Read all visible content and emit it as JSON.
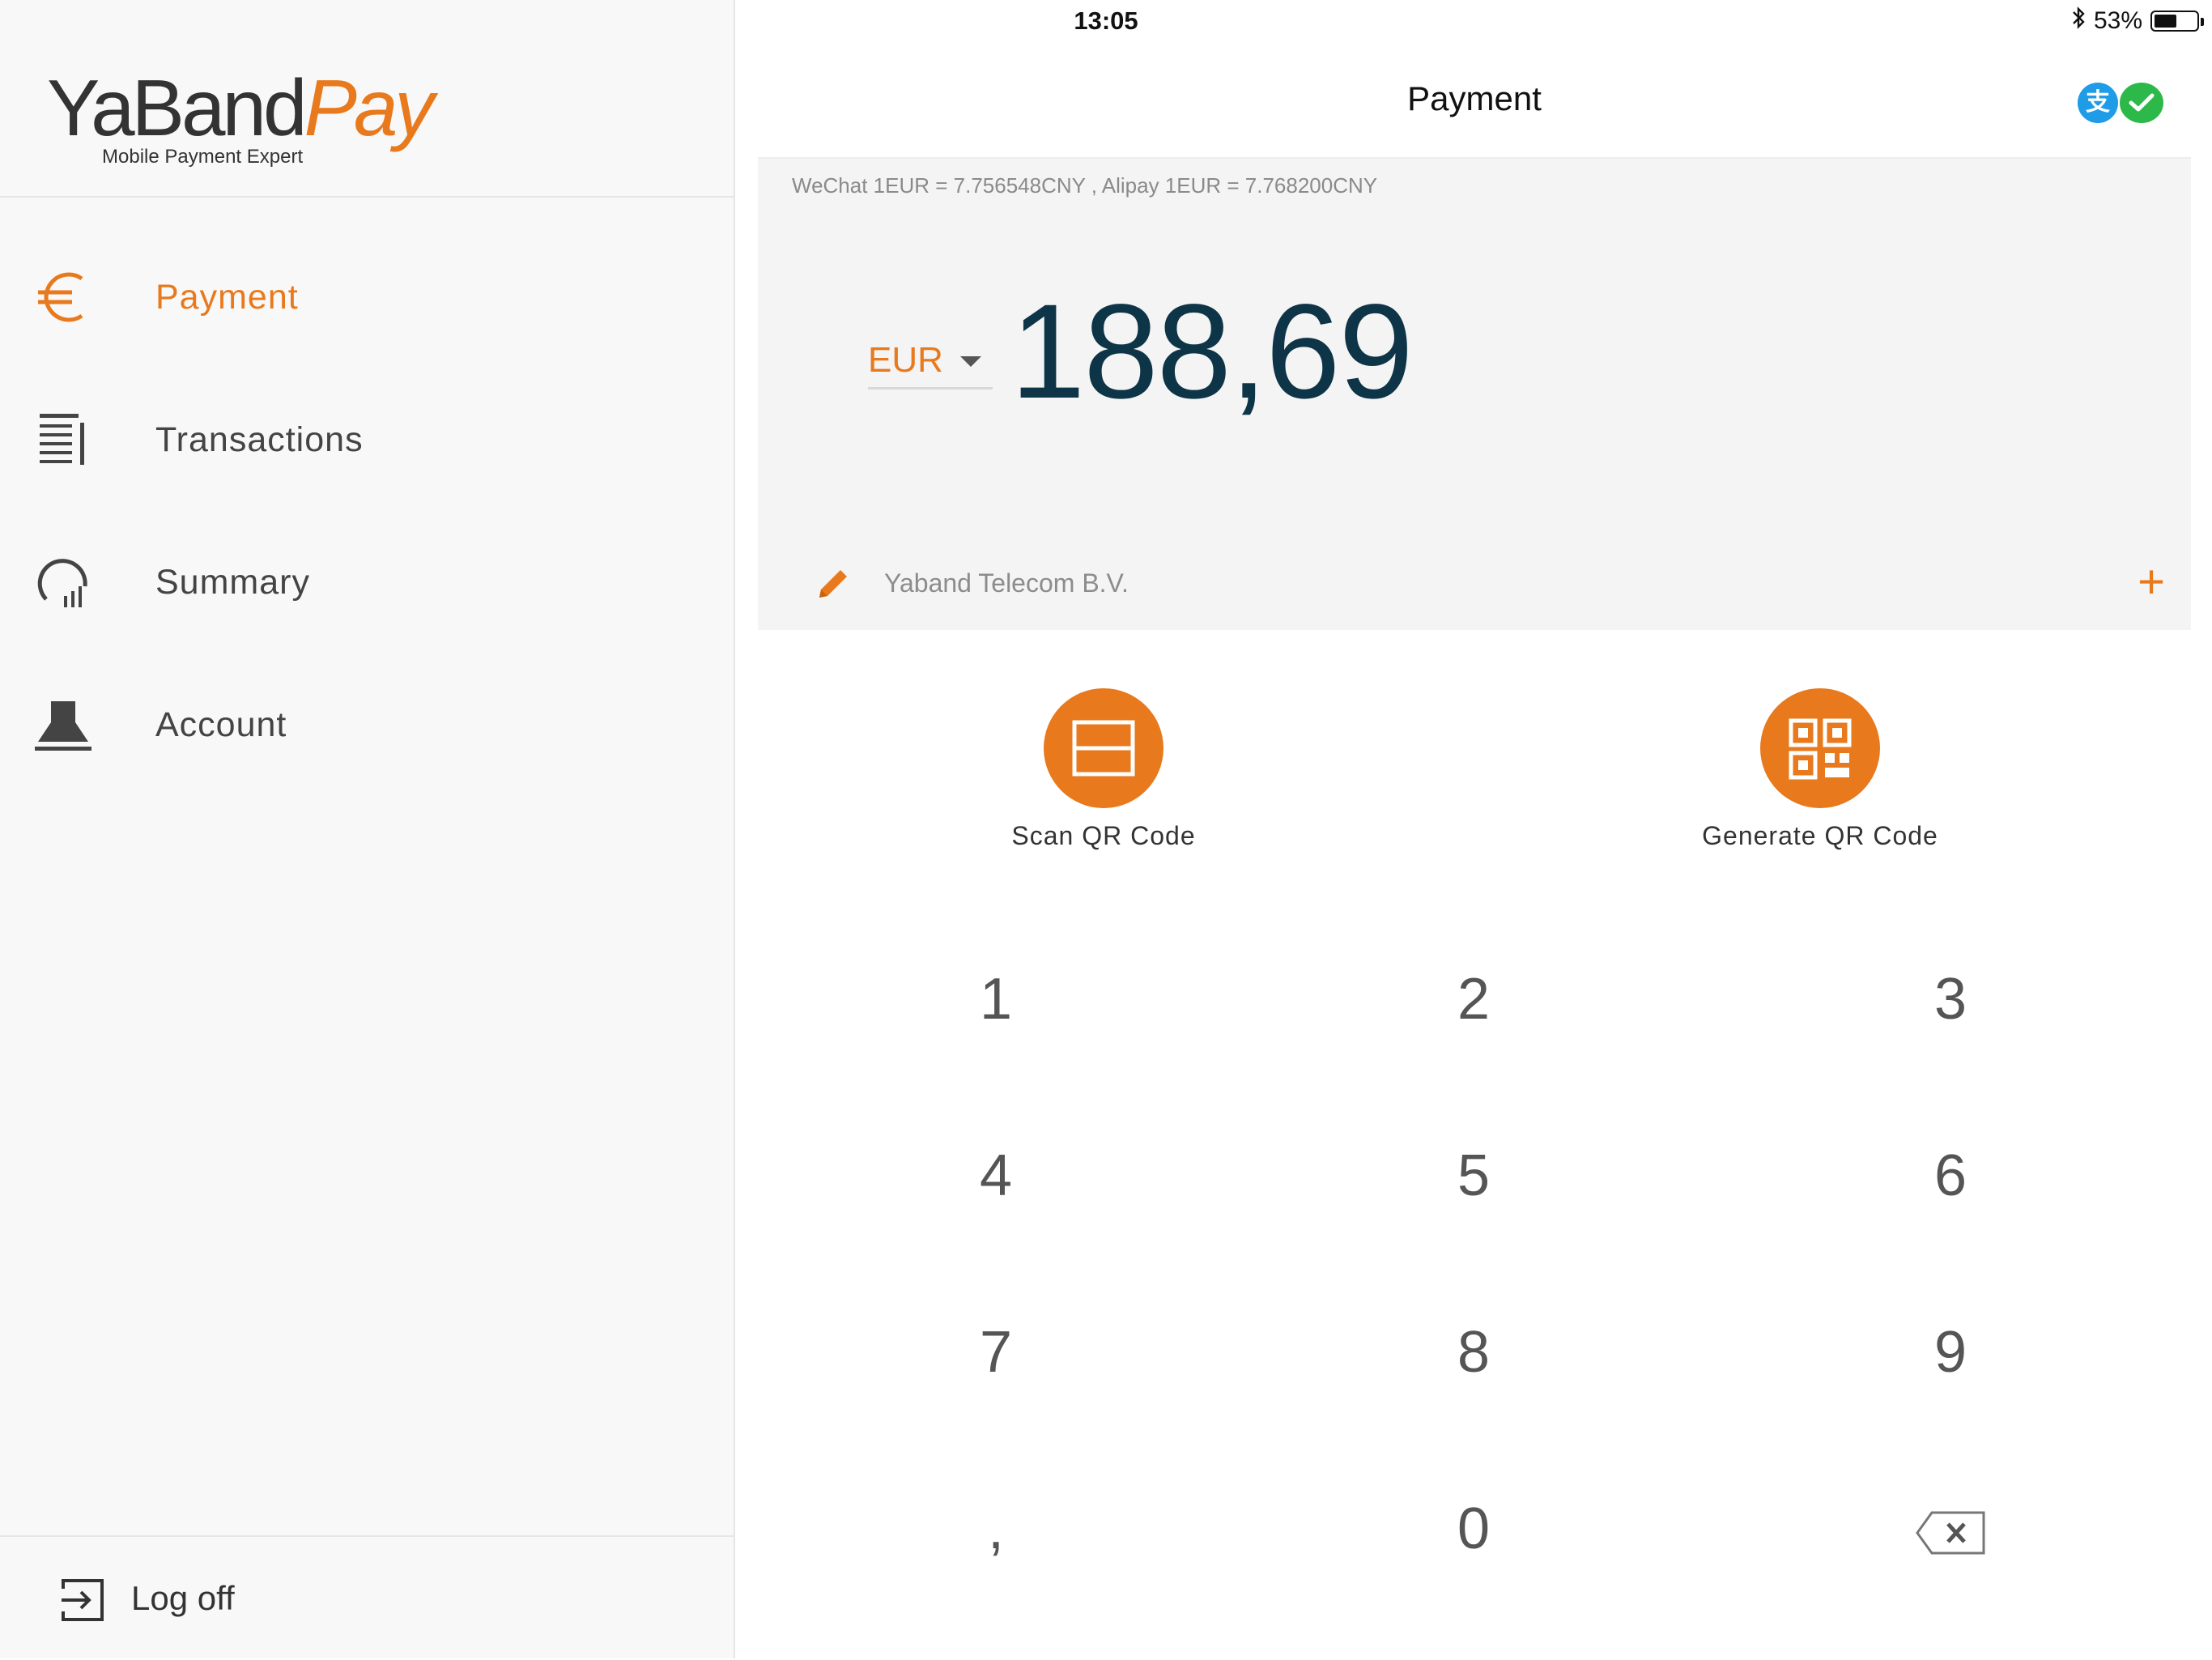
{
  "status_bar": {
    "device": "iPad",
    "time": "13:05",
    "battery": "53%",
    "battery_level": 0.53
  },
  "sidebar": {
    "logo": {
      "brand_main": "YaBand",
      "brand_accent": "Pay",
      "tagline": "Mobile Payment Expert"
    },
    "items": [
      {
        "label": "Payment",
        "icon": "euro-icon",
        "active": true
      },
      {
        "label": "Transactions",
        "icon": "list-icon",
        "active": false
      },
      {
        "label": "Summary",
        "icon": "chart-icon",
        "active": false
      },
      {
        "label": "Account",
        "icon": "user-icon",
        "active": false
      }
    ],
    "logoff_label": "Log off"
  },
  "header": {
    "title": "Payment",
    "alipay_glyph": "支",
    "pay_icons": [
      "alipay-icon",
      "wechat-icon"
    ]
  },
  "amount_panel": {
    "rate_text": "WeChat 1EUR = 7.756548CNY , Alipay 1EUR = 7.768200CNY",
    "currency": "EUR",
    "amount": "188,69",
    "merchant": "Yaband Telecom B.V.",
    "add_symbol": "+"
  },
  "actions": {
    "scan_label": "Scan QR Code",
    "generate_label": "Generate QR Code"
  },
  "keypad": {
    "keys": [
      "1",
      "2",
      "3",
      "4",
      "5",
      "6",
      "7",
      "8",
      "9",
      ",",
      "0"
    ]
  },
  "colors": {
    "accent": "#e8791c",
    "amount_text": "#0d3547",
    "alipay": "#1e9ce8",
    "wechat": "#2db84a"
  }
}
